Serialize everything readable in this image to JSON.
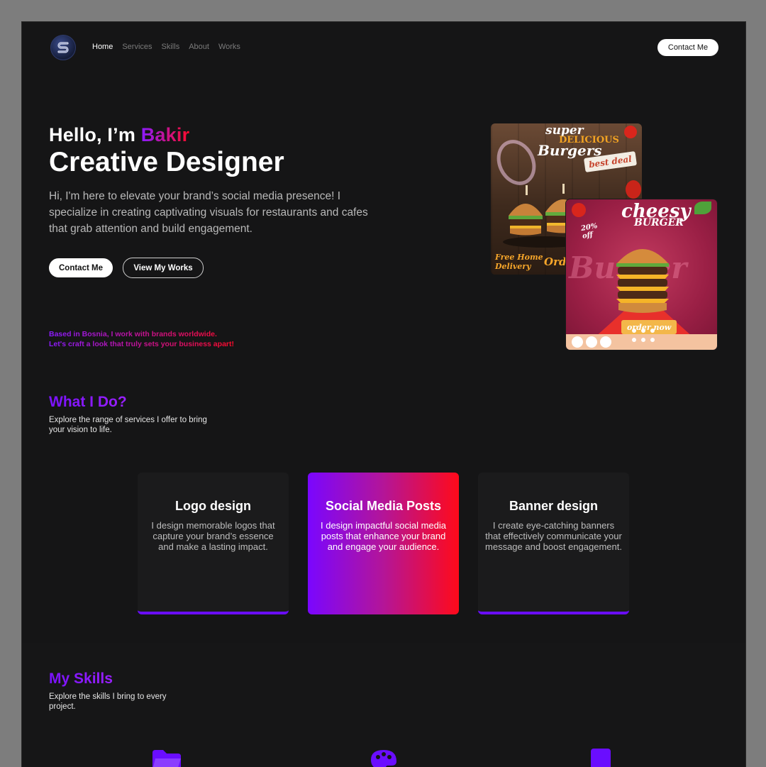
{
  "nav": {
    "items": [
      {
        "label": "Home",
        "active": true
      },
      {
        "label": "Services",
        "active": false
      },
      {
        "label": "Skills",
        "active": false
      },
      {
        "label": "About",
        "active": false
      },
      {
        "label": "Works",
        "active": false
      }
    ],
    "contact_label": "Contact Me"
  },
  "hero": {
    "greeting": "Hello, I’m ",
    "name": "Bakir",
    "role": "Creative Designer",
    "description": "Hi, I'm here to elevate your brand’s social media presence! I specialize in creating captivating visuals for restaurants and cafes that grab attention and build engagement.",
    "contact_button": "Contact Me",
    "works_button": "View My Works",
    "tagline_line1": "Based in Bosnia, I work with brands worldwide.",
    "tagline_line2": "Let's craft a look that truly sets your business apart!"
  },
  "posters": {
    "first": {
      "line1": "super",
      "line2": "DELICIOUS",
      "line3": "Burgers",
      "badge": "best deal",
      "footer1": "Free Home",
      "footer2": "Delivery",
      "footer3": "Ord"
    },
    "second": {
      "title1": "cheesy",
      "title2": "BURGER",
      "discount1": "20%",
      "discount2": "off",
      "bg_word": "Burger",
      "cta": "order now"
    }
  },
  "services": {
    "title": "What I Do?",
    "subtitle": "Explore the range of services I offer to bring your vision to life.",
    "cards": [
      {
        "title": "Logo design",
        "text": "I design memorable logos that capture your brand’s essence and make a lasting impact."
      },
      {
        "title": "Social Media Posts",
        "text": "I design impactful social media posts that enhance your brand and engage your audience."
      },
      {
        "title": "Banner design",
        "text": "I create eye-catching banners that effectively communicate your message and boost engagement."
      }
    ]
  },
  "skills": {
    "title": "My Skills",
    "subtitle": "Explore the skills I bring to every project.",
    "icons": [
      "folder-icon",
      "palette-icon",
      "tablet-icon"
    ]
  },
  "colors": {
    "background": "#151516",
    "accent_purple": "#7a06ff",
    "accent_red": "#ff0a1a"
  }
}
